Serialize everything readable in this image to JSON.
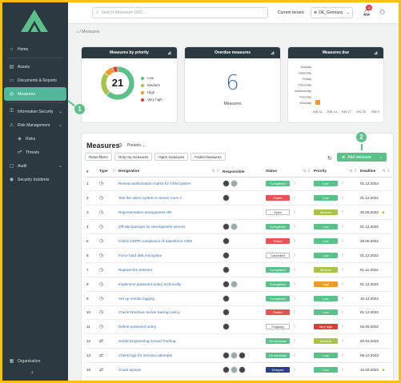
{
  "sidebar": {
    "items": [
      {
        "label": "Home",
        "icon": "home-icon",
        "glyph": "⌂",
        "active": false,
        "chevron": false
      },
      {
        "label": "Assets",
        "icon": "assets-icon",
        "glyph": "▤",
        "active": false,
        "chevron": false
      },
      {
        "label": "Documents & Reports",
        "icon": "documents-icon",
        "glyph": "▭",
        "active": false,
        "chevron": false
      },
      {
        "label": "Measures",
        "icon": "measures-icon",
        "glyph": "◎",
        "active": true,
        "chevron": false
      },
      {
        "label": "Information Security",
        "icon": "lock-icon",
        "glyph": "⚿",
        "active": false,
        "chevron": true
      },
      {
        "label": "Risk Management",
        "icon": "warning-icon",
        "glyph": "⚠",
        "active": false,
        "chevron": true
      },
      {
        "label": "Risks",
        "icon": "risks-icon",
        "glyph": "◈",
        "active": false,
        "chevron": false,
        "sub": true
      },
      {
        "label": "Threats",
        "icon": "threats-icon",
        "glyph": "☍",
        "active": false,
        "chevron": false,
        "sub": true
      },
      {
        "label": "Audit",
        "icon": "audit-icon",
        "glyph": "▢",
        "active": false,
        "chevron": true
      },
      {
        "label": "Security Incidents",
        "icon": "incident-icon",
        "glyph": "◉",
        "active": false,
        "chevron": false
      }
    ],
    "bottom_label": "Organization",
    "collapse_glyph": "‹"
  },
  "callouts": {
    "first": "1",
    "second": "2"
  },
  "topbar": {
    "search_placeholder": "Search Atheneum GRC...",
    "tenant_label": "Current tenant:",
    "tenant_value": "DE_Germany",
    "notification_count": "12"
  },
  "breadcrumb": "Measures",
  "cards": {
    "priority": {
      "title": "Measures by priority",
      "total": "21",
      "legend": [
        {
          "label": "Low",
          "color": "#5cc08a"
        },
        {
          "label": "Medium",
          "color": "#a8c34a"
        },
        {
          "label": "High",
          "color": "#f09a2e"
        },
        {
          "label": "Very high",
          "color": "#e03c3c"
        }
      ],
      "slices": [
        {
          "label": "Low",
          "value": 13,
          "color": "#5cc08a"
        },
        {
          "label": "Medium",
          "value": 5,
          "color": "#a8c34a"
        },
        {
          "label": "High",
          "value": 2,
          "color": "#f09a2e"
        },
        {
          "label": "Very high",
          "value": 1,
          "color": "#e03c3c"
        }
      ]
    },
    "overdue": {
      "title": "Overdue measures",
      "value": "6",
      "label": "Measures"
    },
    "due": {
      "title": "Measures due",
      "days": [
        "Sunday",
        "Saturday",
        "Friday",
        "Thursday",
        "Wednesday",
        "Tuesday",
        "Monday"
      ],
      "weeks": [
        "KW 11",
        "KW 14",
        "KW 17",
        "KW 20",
        "KW 0"
      ],
      "bar_color": "#f09a2e"
    }
  },
  "measures": {
    "title": "Measures",
    "presets_label": "Presets",
    "filters": [
      "Reset filters",
      "Only my measures",
      "Open measures",
      "Failed measures"
    ],
    "add_label": "Add measure",
    "columns": [
      "#",
      "Type",
      "Designation",
      "Responsible",
      "Status",
      "Priority",
      "Deadline"
    ],
    "rows": [
      {
        "n": "1",
        "type": "◷",
        "name": "Review authorization matrix for CRM system",
        "avatars": 2,
        "status": "Completed",
        "sc": "completed",
        "prio": "Low",
        "pc": "low",
        "date": "01.12.2022",
        "warn": false
      },
      {
        "n": "2",
        "type": "◷",
        "name": "Test fire alarm system in server room A",
        "avatars": 1,
        "status": "Failed",
        "sc": "failed",
        "prio": "Low",
        "pc": "low",
        "date": "01.12.2022",
        "warn": false
      },
      {
        "n": "3",
        "type": "◷",
        "name": "Representation arrangement HR",
        "avatars": 0,
        "status": "Open",
        "sc": "open",
        "prio": "Medium",
        "pc": "medium",
        "date": "30.09.2022",
        "warn": true
      },
      {
        "n": "4",
        "type": "◷",
        "name": "Off-site backups for development servers",
        "avatars": 2,
        "status": "Completed",
        "sc": "completed",
        "prio": "Low",
        "pc": "low",
        "date": "01.12.2022",
        "warn": false
      },
      {
        "n": "5",
        "type": "◷",
        "name": "Check GDPR compliance of Salesforce CRM",
        "avatars": 1,
        "status": "Failed",
        "sc": "failed",
        "prio": "Low",
        "pc": "low",
        "date": "26.05.2022",
        "warn": false
      },
      {
        "n": "6",
        "type": "◷",
        "name": "Force hard disk encryption",
        "avatars": 1,
        "status": "Cancelled",
        "sc": "cancelled",
        "prio": "Low",
        "pc": "low",
        "date": "01.12.2022",
        "warn": false
      },
      {
        "n": "7",
        "type": "◷",
        "name": "Replace fire detector",
        "avatars": 1,
        "status": "Completed",
        "sc": "completed",
        "prio": "Medium",
        "pc": "medium",
        "date": "01.11.2022",
        "warn": false
      },
      {
        "n": "8",
        "type": "◷",
        "name": "Implement password policy technically",
        "avatars": 2,
        "status": "Completed",
        "sc": "completed",
        "prio": "High",
        "pc": "high",
        "date": "01.12.2022",
        "warn": false
      },
      {
        "n": "9",
        "type": "◷",
        "name": "Set up remote logging",
        "avatars": 1,
        "status": "Completed",
        "sc": "completed",
        "prio": "Low",
        "pc": "low",
        "date": "15.12.2022",
        "warn": false
      },
      {
        "n": "10",
        "type": "◷",
        "name": "Check Windows Server backup policy",
        "avatars": 1,
        "status": "Failed",
        "sc": "failed",
        "prio": "Low",
        "pc": "low",
        "date": "01.12.2022",
        "warn": false
      },
      {
        "n": "11",
        "type": "◷",
        "name": "Define password policy",
        "avatars": 1,
        "status": "Ongoing",
        "sc": "ongoing",
        "prio": "Very high",
        "pc": "veryhigh",
        "date": "02.09.2022",
        "warn": false
      },
      {
        "n": "12",
        "type": "⇄",
        "name": "Social Engineering Annual Training",
        "avatars": 0,
        "status": "On schedule",
        "sc": "onschedule",
        "prio": "Medium",
        "pc": "medium",
        "date": "20.03.2023",
        "warn": false
      },
      {
        "n": "13",
        "type": "⇄",
        "name": "Check logs for intrusion attempts",
        "avatars": 3,
        "status": "On schedule",
        "sc": "onschedule",
        "prio": "Low",
        "pc": "low",
        "date": "06.10.2023",
        "warn": false
      },
      {
        "n": "19",
        "type": "⇄",
        "name": "Count laptops",
        "avatars": 3,
        "status": "Delayed",
        "sc": "delayed",
        "prio": "Low",
        "pc": "low",
        "date": "16.02.2023",
        "warn": true
      },
      {
        "n": "20",
        "type": "⇄",
        "name": "Define BCM policy",
        "avatars": 1,
        "status": "Open",
        "sc": "open",
        "prio": "Low",
        "pc": "low",
        "date": "10.07.2023",
        "warn": false
      }
    ]
  }
}
